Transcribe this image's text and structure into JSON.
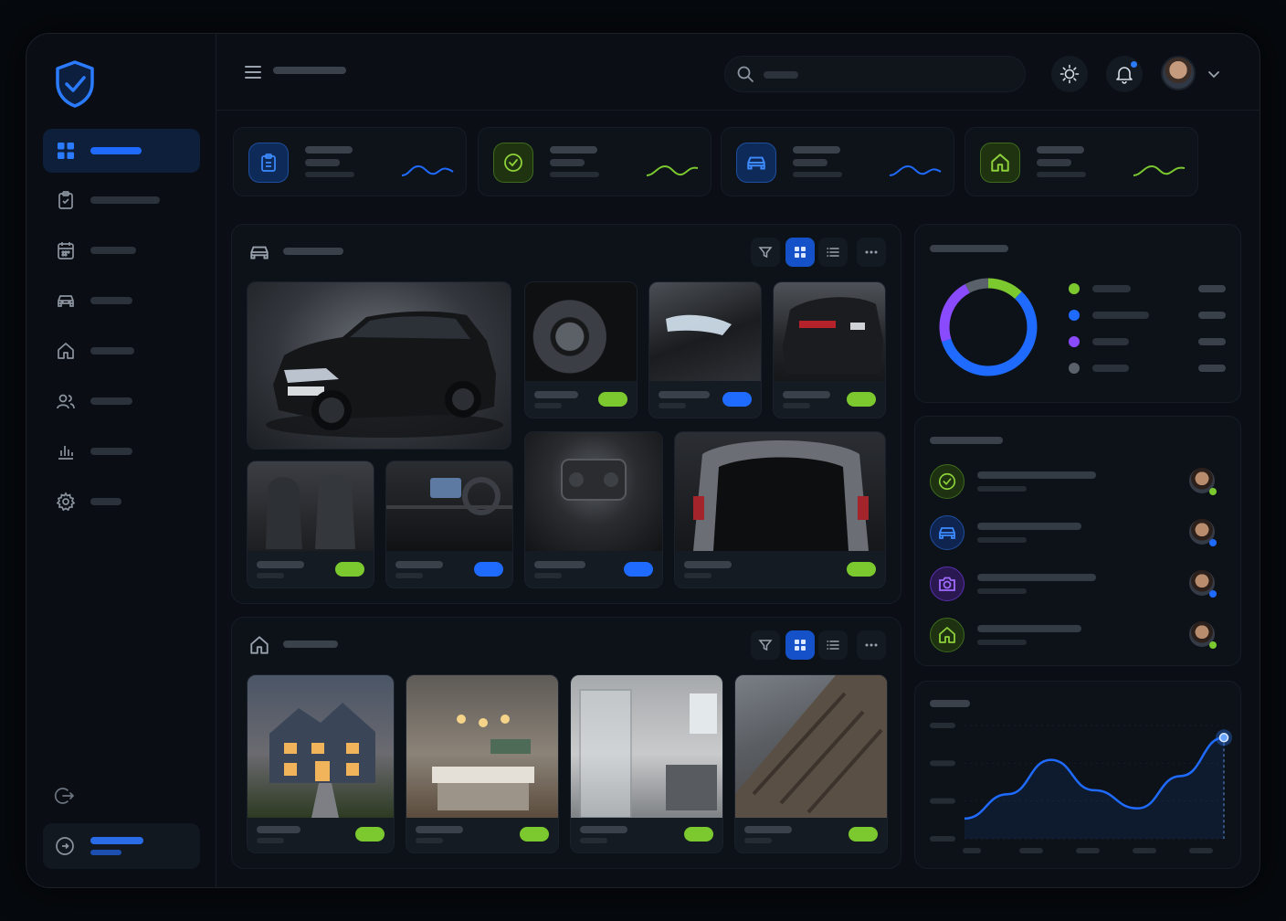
{
  "app": {
    "name": ""
  },
  "sidebar": {
    "items": [
      {
        "icon": "grid-icon",
        "label": "",
        "active": true
      },
      {
        "icon": "clipboard-icon",
        "label": ""
      },
      {
        "icon": "calendar-icon",
        "label": ""
      },
      {
        "icon": "car-icon",
        "label": ""
      },
      {
        "icon": "home-icon",
        "label": ""
      },
      {
        "icon": "users-icon",
        "label": ""
      },
      {
        "icon": "bar-chart-icon",
        "label": ""
      },
      {
        "icon": "settings-icon",
        "label": ""
      }
    ],
    "logout_icon": "logout-icon",
    "account_icon": "account-icon"
  },
  "topbar": {
    "title": "",
    "search_placeholder": "",
    "theme_icon": "sun-icon",
    "notifications_icon": "bell-icon",
    "has_unread": true
  },
  "stats": [
    {
      "icon": "clipboard-icon",
      "color": "#1f6bff",
      "trend": "wave-blue"
    },
    {
      "icon": "check-icon",
      "color": "#7cc92f",
      "trend": "wave-green"
    },
    {
      "icon": "car-icon",
      "color": "#1f6bff",
      "trend": "wave-blue"
    },
    {
      "icon": "home-icon",
      "color": "#7cc92f",
      "trend": "wave-green"
    }
  ],
  "vehicle_panel": {
    "title": "",
    "toolbar": [
      "filter-icon",
      "grid-view-icon",
      "list-view-icon",
      "more-icon"
    ],
    "cards": [
      {
        "name": "",
        "subject": "black-suv-front",
        "status_color": null
      },
      {
        "name": "",
        "subject": "wheel-rim",
        "status_color": "#7cc92f"
      },
      {
        "name": "",
        "subject": "headlight",
        "status_color": "#1f6bff"
      },
      {
        "name": "",
        "subject": "rear-quarter",
        "status_color": "#7cc92f"
      },
      {
        "name": "",
        "subject": "front-seats",
        "status_color": "#7cc92f"
      },
      {
        "name": "",
        "subject": "dashboard",
        "status_color": "#1f6bff"
      },
      {
        "name": "",
        "subject": "engine-bay",
        "status_color": "#1f6bff"
      },
      {
        "name": "",
        "subject": "trunk",
        "status_color": "#7cc92f"
      }
    ]
  },
  "property_panel": {
    "title": "",
    "toolbar": [
      "filter-icon",
      "grid-view-icon",
      "list-view-icon",
      "more-icon"
    ],
    "cards": [
      {
        "name": "",
        "subject": "house-exterior-dusk",
        "status_color": "#7cc92f"
      },
      {
        "name": "",
        "subject": "kitchen",
        "status_color": "#7cc92f"
      },
      {
        "name": "",
        "subject": "bathroom",
        "status_color": "#7cc92f"
      },
      {
        "name": "",
        "subject": "roof-shingles",
        "status_color": "#7cc92f"
      }
    ]
  },
  "donut_panel": {
    "title": "",
    "segments": [
      {
        "label": "",
        "color": "#7cc92f",
        "share": 0.12
      },
      {
        "label": "",
        "color": "#1f6bff",
        "share": 0.58
      },
      {
        "label": "",
        "color": "#8a4bff",
        "share": 0.22
      },
      {
        "label": "",
        "color": "#5a616b",
        "share": 0.08
      }
    ]
  },
  "activity_panel": {
    "title": "",
    "items": [
      {
        "icon": "check-icon",
        "color": "#7cc92f",
        "status_color": "#7cc92f"
      },
      {
        "icon": "car-icon",
        "color": "#1f6bff",
        "status_color": "#1f6bff"
      },
      {
        "icon": "camera-icon",
        "color": "#8a4bff",
        "status_color": "#1f6bff"
      },
      {
        "icon": "home-icon",
        "color": "#7cc92f",
        "status_color": "#7cc92f"
      }
    ]
  },
  "line_panel": {
    "title": ""
  },
  "chart_data": {
    "type": "line",
    "title": "",
    "x": [
      0,
      1,
      2,
      3,
      4,
      5,
      6
    ],
    "series": [
      {
        "values": [
          1.0,
          2.2,
          3.9,
          2.4,
          1.5,
          3.1,
          5.0
        ]
      }
    ],
    "highlight_index": 6,
    "ylim": [
      0,
      5.6
    ],
    "grid": true
  }
}
